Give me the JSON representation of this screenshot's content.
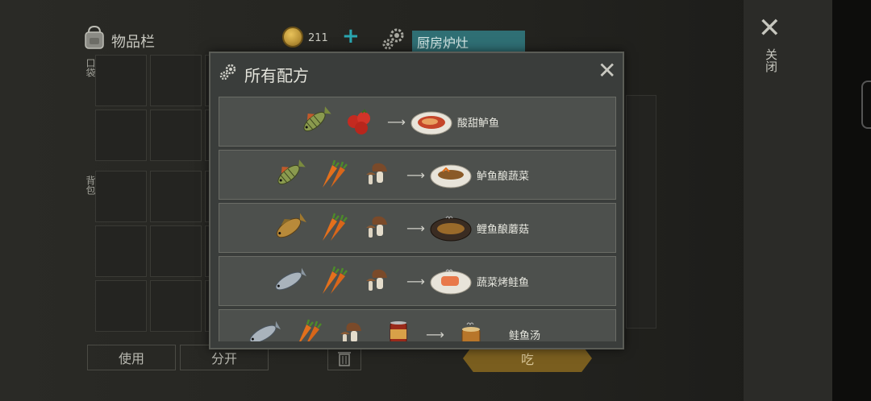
{
  "inventory": {
    "title": "物品栏",
    "pocket_label": "口袋",
    "backpack_label": "背包"
  },
  "currency": {
    "coins": "211",
    "add_symbol": "+"
  },
  "kitchen": {
    "tab_label": "厨房炉灶"
  },
  "actions": {
    "use_label": "使用",
    "split_label": "分开",
    "eat_label": "吃"
  },
  "close": {
    "label": "关闭"
  },
  "modal": {
    "title": "所有配方",
    "close_symbol": "✕",
    "arrow_symbol": "⟶",
    "recipes": [
      {
        "ingredients": [
          "perch-icon",
          "tomato-icon"
        ],
        "dish_icon": "sweet-sour-perch-icon",
        "name": "酸甜鲈鱼"
      },
      {
        "ingredients": [
          "perch-icon",
          "carrot-icon",
          "mushroom-icon"
        ],
        "dish_icon": "perch-pickle-dish-icon",
        "name": "鲈鱼酿蔬菜"
      },
      {
        "ingredients": [
          "carp-icon",
          "carrot-icon",
          "mushroom-icon"
        ],
        "dish_icon": "carp-mushroom-dish-icon",
        "name": "鲤鱼酿蘑菇"
      },
      {
        "ingredients": [
          "salmon-icon",
          "carrot-icon",
          "mushroom-icon"
        ],
        "dish_icon": "grilled-salmon-dish-icon",
        "name": "蔬菜烤鲑鱼"
      },
      {
        "ingredients": [
          "salmon-icon",
          "carrot-icon",
          "mushroom-icon",
          "can-icon"
        ],
        "dish_icon": "salmon-soup-icon",
        "name": "鲑鱼汤"
      }
    ]
  },
  "colors": {
    "accent_teal": "#2f6f74",
    "coin_gold": "#e8c25a",
    "eat_button": "#7a5e1f",
    "modal_bg": "#3a3d3b",
    "row_bg": "#4d504d"
  }
}
